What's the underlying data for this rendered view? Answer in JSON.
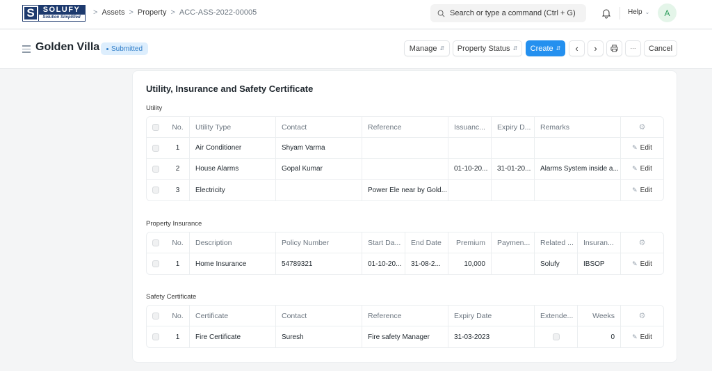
{
  "navbar": {
    "logo": {
      "mark": "S",
      "name": "SOLUFY",
      "tagline": "Solution Simplified"
    },
    "breadcrumb": [
      "Assets",
      "Property",
      "ACC-ASS-2022-00005"
    ],
    "search_placeholder": "Search or type a command (Ctrl + G)",
    "help_label": "Help",
    "avatar_initial": "A"
  },
  "header": {
    "title": "Golden Villa",
    "status": "Submitted",
    "buttons": {
      "manage": "Manage",
      "property_status": "Property Status",
      "create": "Create",
      "more": "···",
      "cancel": "Cancel"
    }
  },
  "section": {
    "title": "Utility, Insurance and Safety Certificate",
    "utility": {
      "label": "Utility",
      "columns": [
        "No.",
        "Utility Type",
        "Contact",
        "Reference",
        "Issuanc...",
        "Expiry D...",
        "Remarks"
      ],
      "rows": [
        {
          "no": "1",
          "type": "Air Conditioner",
          "contact": "Shyam Varma",
          "reference": "",
          "issuance": "",
          "expiry": "",
          "remarks": ""
        },
        {
          "no": "2",
          "type": "House Alarms",
          "contact": "Gopal Kumar",
          "reference": "",
          "issuance": "01-10-20...",
          "expiry": "31-01-20...",
          "remarks": "Alarms System inside a..."
        },
        {
          "no": "3",
          "type": "Electricity",
          "contact": "",
          "reference": "Power Ele near by Gold...",
          "issuance": "",
          "expiry": "",
          "remarks": ""
        }
      ]
    },
    "insurance": {
      "label": "Property Insurance",
      "columns": [
        "No.",
        "Description",
        "Policy Number",
        "Start Da...",
        "End Date",
        "Premium",
        "Paymen...",
        "Related ...",
        "Insuran..."
      ],
      "rows": [
        {
          "no": "1",
          "description": "Home Insurance",
          "policy": "54789321",
          "start": "01-10-20...",
          "end": "31-08-2...",
          "premium": "10,000",
          "payment": "",
          "related": "Solufy",
          "insurer": "IBSOP"
        }
      ]
    },
    "safety": {
      "label": "Safety Certificate",
      "columns": [
        "No.",
        "Certificate",
        "Contact",
        "Reference",
        "Expiry Date",
        "Extende...",
        "Weeks"
      ],
      "rows": [
        {
          "no": "1",
          "certificate": "Fire Certificate",
          "contact": "Suresh",
          "reference": "Fire safety Manager",
          "expiry": "31-03-2023",
          "extended": false,
          "weeks": "0"
        }
      ]
    },
    "edit_label": "Edit"
  }
}
